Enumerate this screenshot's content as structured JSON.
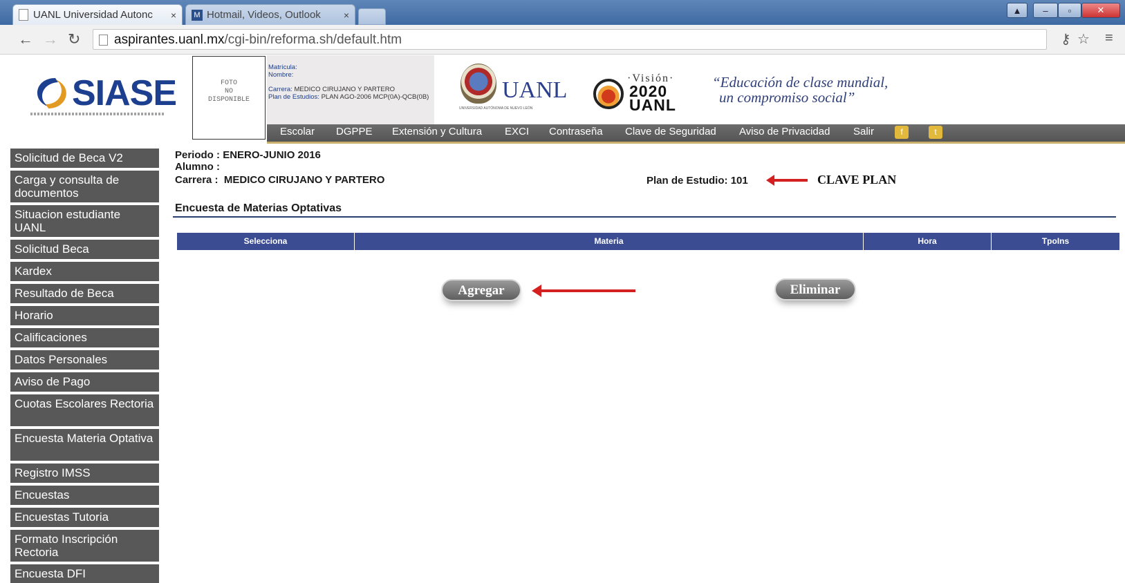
{
  "browser": {
    "tabs": [
      {
        "label": "UANL Universidad Autonc",
        "close": "×"
      },
      {
        "label": "Hotmail, Videos, Outlook",
        "close": "×"
      }
    ],
    "url_host": "aspirantes.uanl.mx",
    "url_path": "/cgi-bin/reforma.sh/default.htm",
    "icons": [
      "back-arrow-icon",
      "forward-arrow-icon",
      "reload-icon",
      "page-icon",
      "key-icon",
      "star-icon",
      "menu-icon"
    ]
  },
  "header": {
    "logo_text": "SIASE",
    "photo_text": [
      "FOTO",
      "NO",
      "DISPONIBLE"
    ],
    "student": {
      "matricula_label": "Matrícula:",
      "nombre_label": "Nombre:",
      "carrera_label": "Carrera:",
      "carrera_value": "MEDICO CIRUJANO Y PARTERO",
      "plan_label": "Plan de Estudios:",
      "plan_value": "PLAN AGO-2006 MCP(0A)-QCB(0B)"
    },
    "uanl_text": "UANL",
    "uanl_sub": "UNIVERSIDAD AUTÓNOMA DE NUEVO LEÓN",
    "vision_word": "·Visión·",
    "vision_year_1": "2020",
    "vision_year_2": "UANL",
    "slogan_line1": "“Educación de clase mundial,",
    "slogan_line2": "un compromiso social”"
  },
  "topnav": [
    "Escolar",
    "DGPPE",
    "Extensión y Cultura",
    "EXCI",
    "Contraseña",
    "Clave de Seguridad",
    "Aviso de Privacidad",
    "Salir"
  ],
  "sidebar": [
    "Solicitud de Beca V2",
    "Carga y consulta de documentos",
    "Situacion estudiante UANL",
    "Solicitud Beca",
    "Kardex",
    "Resultado de Beca",
    "Horario",
    "Calificaciones",
    "Datos Personales",
    "Aviso de Pago",
    "Cuotas Escolares Rectoria",
    "Encuesta Materia Optativa",
    "Registro IMSS",
    "Encuestas",
    "Encuestas Tutoria",
    "Formato Inscripción Rectoria",
    "Encuesta DFI"
  ],
  "main": {
    "periodo_label": "Periodo :",
    "periodo_value": "ENERO-JUNIO 2016",
    "alumno_label": "Alumno :",
    "carrera_label": "Carrera :",
    "carrera_value": "MEDICO CIRUJANO Y PARTERO",
    "plan_label": "Plan de Estudio:",
    "plan_value": "101",
    "clave_plan_note": "CLAVE PLAN",
    "section_title": "Encuesta de Materias Optativas",
    "columns": [
      "Selecciona",
      "Materia",
      "Hora",
      "TpoIns"
    ],
    "add_button": "Agregar",
    "delete_button": "Eliminar"
  },
  "colors": {
    "grid_header": "#3b4c93",
    "sidebar_bg": "#585858",
    "annotation_arrow": "#d42020",
    "nav_bg": "#5f5f5f"
  }
}
